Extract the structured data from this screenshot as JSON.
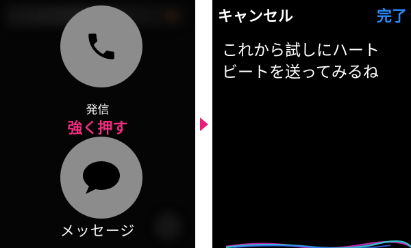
{
  "left_screen": {
    "call_label": "発信",
    "press_hint": "強く押す",
    "message_label": "メッセージ",
    "call_icon": "phone-icon",
    "message_icon": "speech-bubble-icon"
  },
  "right_screen": {
    "cancel_label": "キャンセル",
    "done_label": "完了",
    "dictation_lines": [
      "これから試しにハート",
      "ビートを送ってみるね"
    ],
    "wave_icon": "siri-waveform-icon"
  },
  "colors": {
    "highlight": "#f02d7e",
    "done": "#2a8cff",
    "circle": "#8c8c8c",
    "arrow": "#e91e78"
  }
}
